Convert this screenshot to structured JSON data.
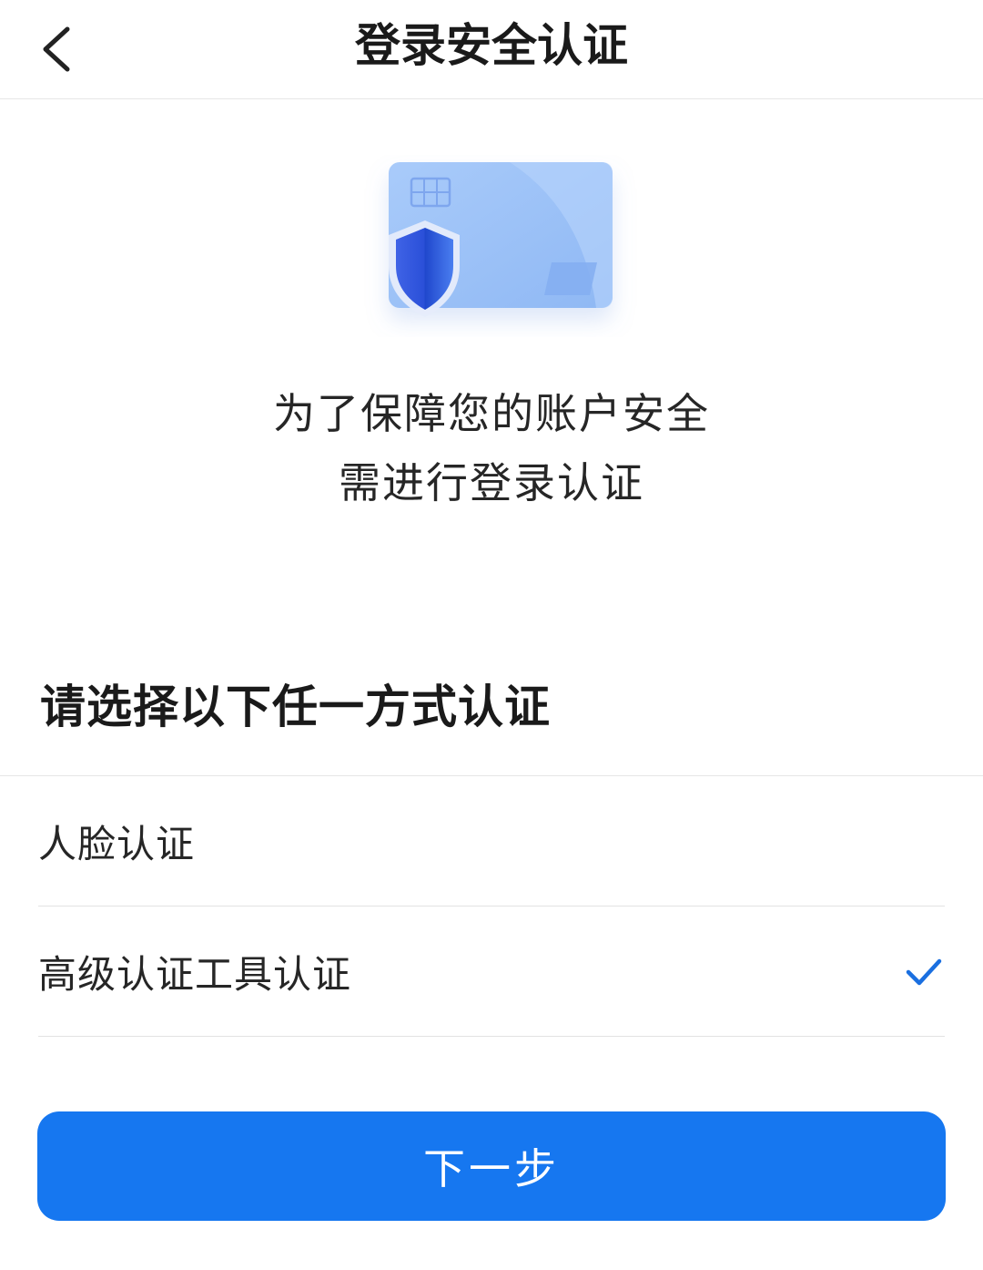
{
  "header": {
    "title": "登录安全认证",
    "back_icon": "chevron-left-icon"
  },
  "hero": {
    "illustration": "security-card-with-shield",
    "colors": {
      "card": "#9cc1f7",
      "shield": "#2f5ee0"
    }
  },
  "intro": {
    "line1": "为了保障您的账户安全",
    "line2": "需进行登录认证"
  },
  "section": {
    "title": "请选择以下任一方式认证"
  },
  "options": [
    {
      "label": "人脸认证",
      "selected": false
    },
    {
      "label": "高级认证工具认证",
      "selected": true
    }
  ],
  "actions": {
    "next_label": "下一步"
  },
  "colors": {
    "accent": "#1677f0",
    "check": "#1a6fe0"
  }
}
